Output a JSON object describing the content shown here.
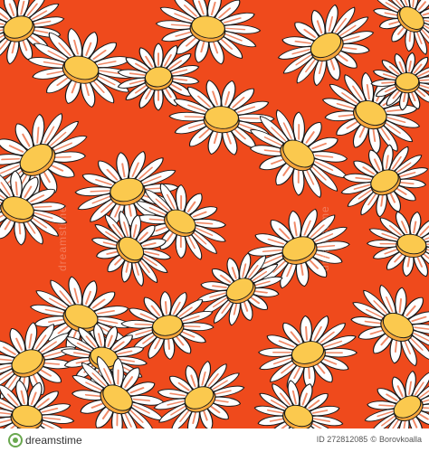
{
  "image": {
    "subject": "daisy-flower-seamless-pattern",
    "colors": {
      "background": "#ef4a1c",
      "petal": "#ffffff",
      "petal_stripe": "#f08a68",
      "center": "#fbc94e",
      "center_shade": "#f7a63b",
      "outline": "#1a1a1a"
    }
  },
  "watermark": {
    "brand": "dreamstime",
    "stock_id_text": "ID 272812085",
    "author": "Borovkoalla"
  }
}
